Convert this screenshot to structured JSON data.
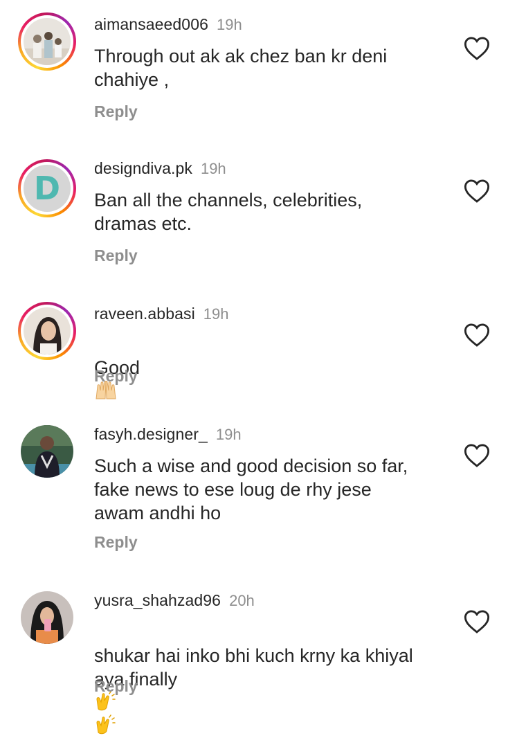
{
  "comments": [
    {
      "username": "aimansaeed006",
      "time": "19h",
      "text": "Through out ak ak chez ban kr deni\nchahiye ,",
      "reply": "Reply",
      "emoji": ""
    },
    {
      "username": "designdiva.pk",
      "time": "19h",
      "text": "Ban all the channels, celebrities,\ndramas etc.",
      "reply": "Reply",
      "emoji": ""
    },
    {
      "username": "raveen.abbasi",
      "time": "19h",
      "text": "Good",
      "reply": "Reply",
      "emoji": "raised-hands"
    },
    {
      "username": "fasyh.designer_",
      "time": "19h",
      "text": "Such a wise and good decision so far,\nfake news to ese loug de rhy jese\nawam andhi ho",
      "reply": "Reply",
      "emoji": ""
    },
    {
      "username": "yusra_shahzad96",
      "time": "20h",
      "text": "shukar hai inko bhi kuch krny ka khiyal\naya finally",
      "reply": "Reply",
      "emoji": "clapping-hands-x2"
    }
  ],
  "avatar_letter": "D",
  "colors": {
    "text": "#262626",
    "muted": "#8e8e8e",
    "story_ring": "#e91e63",
    "designdiva_teal": "#4fb8b0"
  }
}
